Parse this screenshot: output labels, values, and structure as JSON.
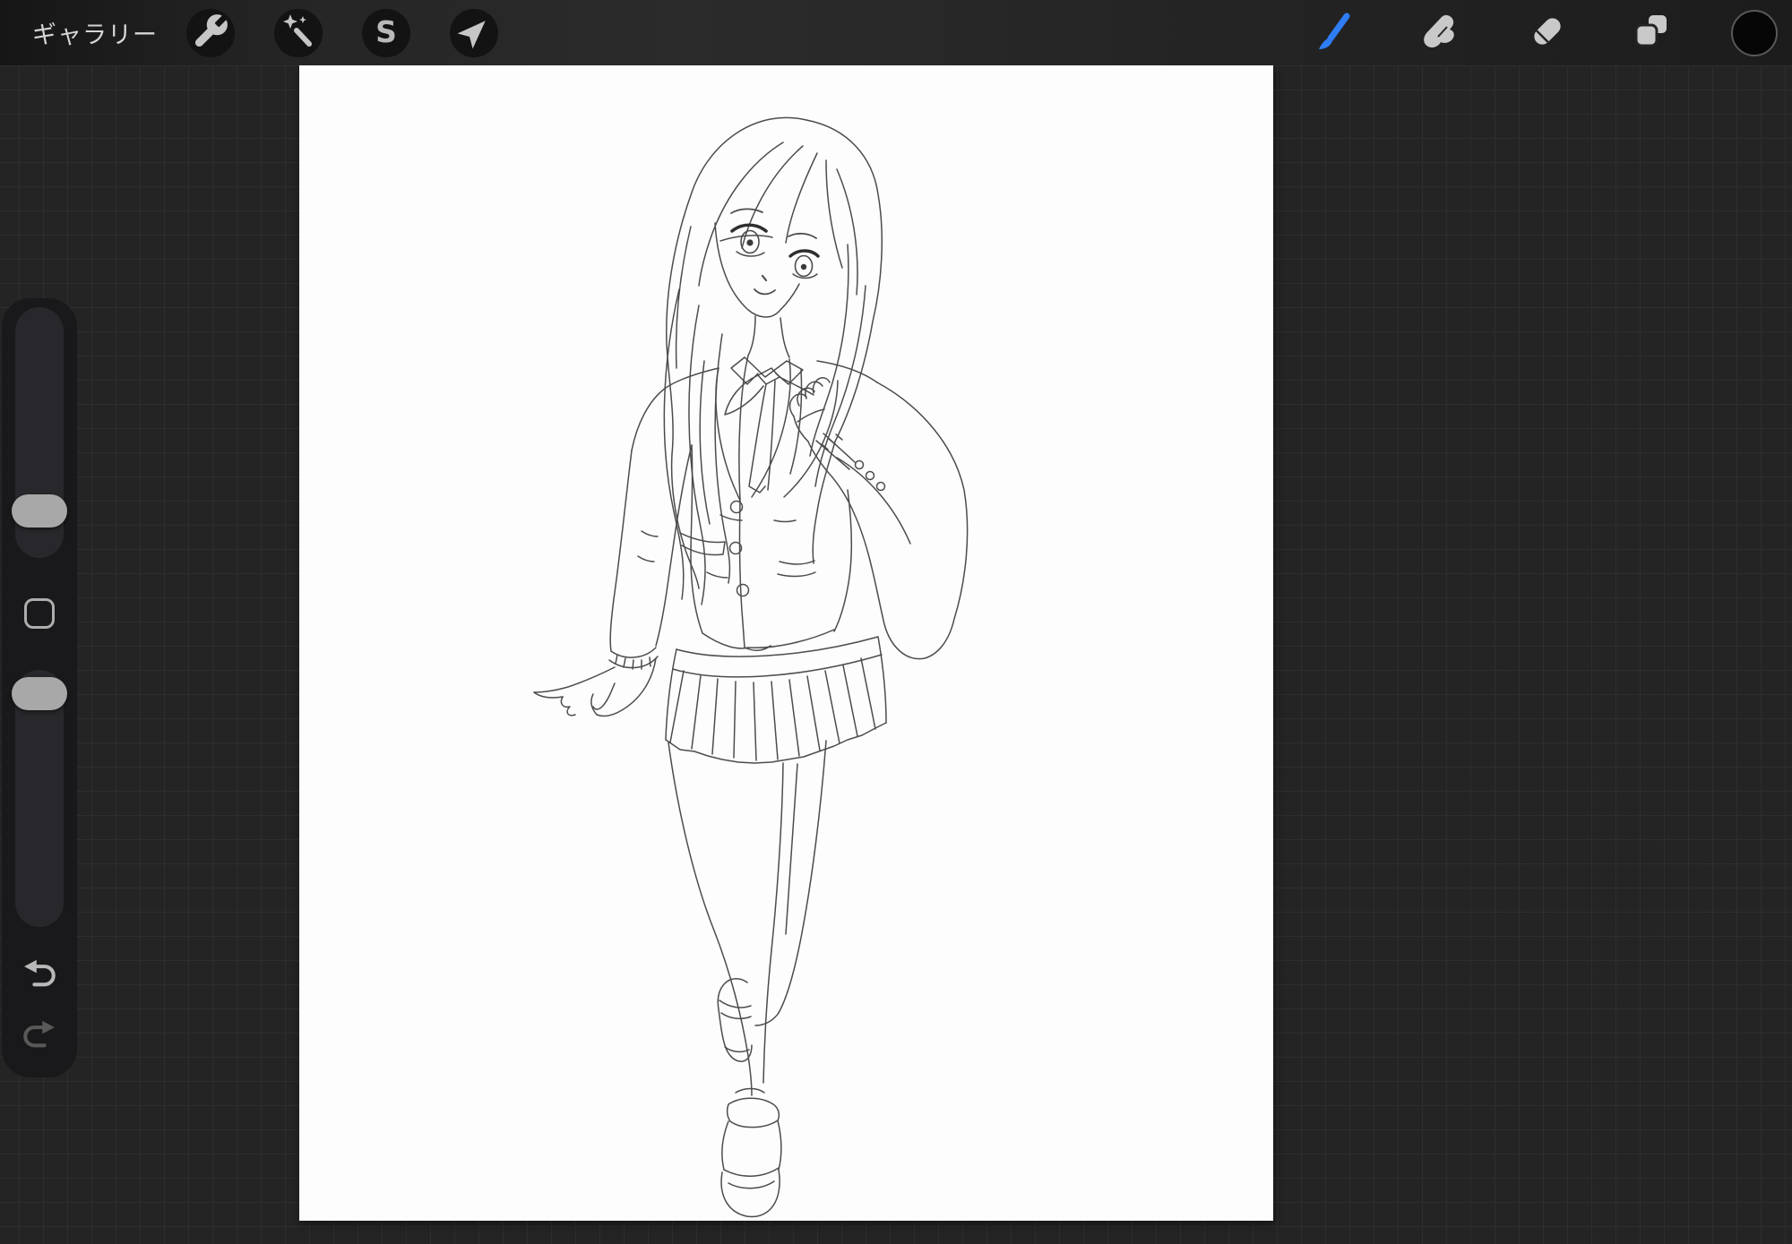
{
  "topbar": {
    "gallery_label": "ギャラリー",
    "left_tools": [
      {
        "id": "actions",
        "icon": "wrench-icon"
      },
      {
        "id": "adjustments",
        "icon": "magic-wand-icon"
      },
      {
        "id": "selection",
        "icon": "selection-s-icon",
        "glyph": "S"
      },
      {
        "id": "transform",
        "icon": "transform-arrow-icon"
      }
    ],
    "right_tools": [
      {
        "id": "brush",
        "icon": "paint-brush-icon",
        "selected": true
      },
      {
        "id": "smudge",
        "icon": "smudge-finger-icon",
        "selected": false
      },
      {
        "id": "eraser",
        "icon": "eraser-icon",
        "selected": false
      },
      {
        "id": "layers",
        "icon": "layers-icon",
        "selected": false
      },
      {
        "id": "color",
        "icon": "color-swatch",
        "swatch_color": "#060606"
      }
    ]
  },
  "sidebar": {
    "sliders": [
      {
        "id": "brush-size"
      },
      {
        "id": "opacity"
      }
    ],
    "modify_button": {
      "icon": "square-icon"
    },
    "undo_icon": "undo-arrow-icon",
    "redo_icon": "redo-arrow-icon"
  },
  "canvas": {
    "description": "Pencil line-art sketch of a long-haired girl in a school uniform: blazer with three buttons, neck ribbon bow, pleated mini skirt and platform loafers, one hand raised to her chest"
  },
  "colors": {
    "workspace_background": "#242424",
    "grid_line": "#2e2e2e",
    "topbar_background": "#232323",
    "panel_background": "#19191b",
    "icon_gray": "#c6c6c6",
    "accent_blue": "#2e7df5",
    "canvas_white": "#fdfdfd"
  }
}
